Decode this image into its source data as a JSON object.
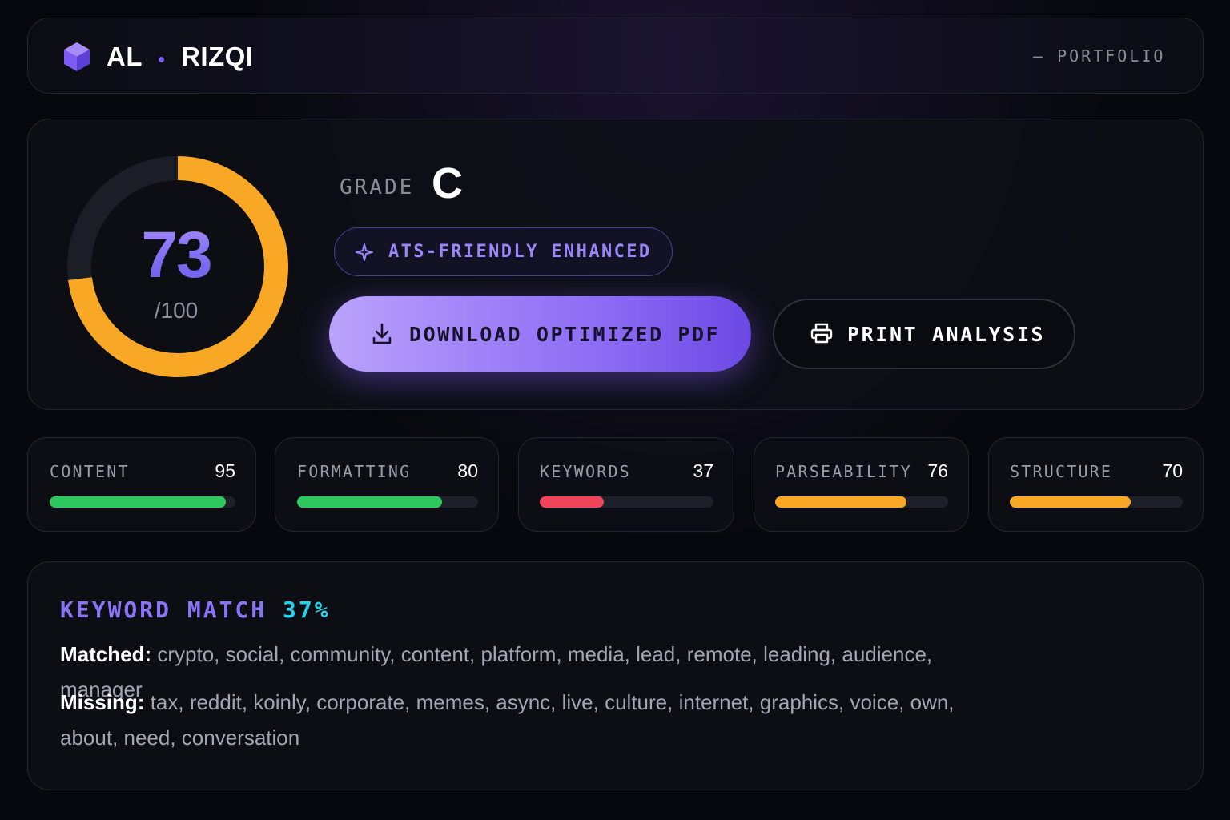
{
  "header": {
    "brand_first": "AL",
    "brand_last": "RIZQI",
    "nav_link": "— PORTFOLIO",
    "logo_icon": "cube-icon"
  },
  "score": {
    "value": "73",
    "max_label": "/100",
    "progress": 0.73,
    "ring_color": "#f9a826",
    "grade_label": "GRADE",
    "grade": "C",
    "badge": "ATS-FRIENDLY ENHANCED",
    "badge_icon": "sparkle-icon"
  },
  "actions": {
    "download_label": "DOWNLOAD OPTIMIZED PDF",
    "download_icon": "download-icon",
    "print_label": "PRINT ANALYSIS",
    "print_icon": "printer-icon"
  },
  "metrics": [
    {
      "label": "CONTENT",
      "value": "95",
      "fraction": 0.95,
      "color": "#2fc85e"
    },
    {
      "label": "FORMATTING",
      "value": "80",
      "fraction": 0.8,
      "color": "#2fc85e"
    },
    {
      "label": "KEYWORDS",
      "value": "37",
      "fraction": 0.37,
      "color": "#f0445a"
    },
    {
      "label": "PARSEABILITY",
      "value": "76",
      "fraction": 0.76,
      "color": "#f9a826"
    },
    {
      "label": "STRUCTURE",
      "value": "70",
      "fraction": 0.7,
      "color": "#f9a826"
    }
  ],
  "keywords": {
    "title": "KEYWORD MATCH",
    "percent": "37%",
    "matched_label": "Matched:",
    "matched": "crypto, social, community, content, platform, media, lead, remote, leading, audience, manager",
    "missing_label": "Missing:",
    "missing": "tax, reddit, koinly, corporate, memes, async, live, culture, internet, graphics, voice, own, about, need, conversation"
  }
}
